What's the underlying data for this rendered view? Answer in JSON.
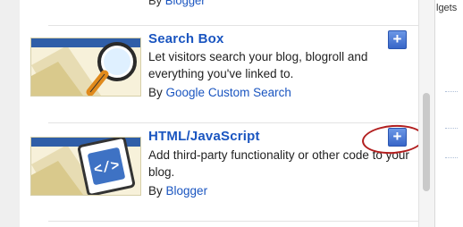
{
  "top_partial": {
    "prefix": "By",
    "link": "Blogger"
  },
  "widgets": [
    {
      "title": "Search Box",
      "description": "Let visitors search your blog, blogroll and everything you've linked to.",
      "by_label": "By",
      "author": "Google Custom Search",
      "thumbnail_icon": "magnifier-icon",
      "add_button_label": "+"
    },
    {
      "title": "HTML/JavaScript",
      "description": "Add third-party functionality or other code to your blog.",
      "by_label": "By",
      "author": "Blogger",
      "thumbnail_icon": "code-icon",
      "add_button_label": "+"
    }
  ],
  "right_panel": {
    "partial_text": "lgets"
  },
  "colors": {
    "link": "#1a55c0",
    "add_button": "#3866c8",
    "highlight": "#b21f1f"
  }
}
